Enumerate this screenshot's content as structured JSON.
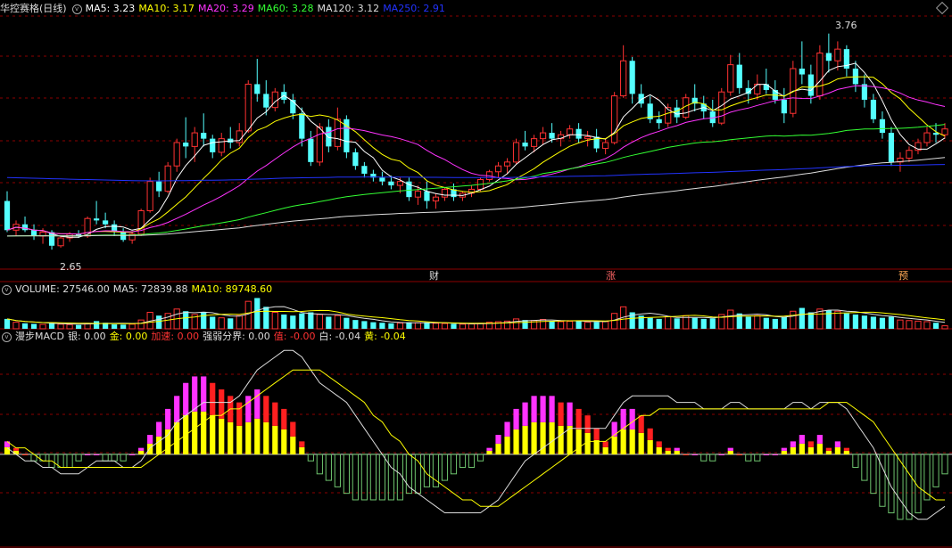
{
  "panels": {
    "price": {
      "title": "华控赛格(日线)",
      "legend": [
        {
          "label": "MA5: 3.23",
          "color": "#ffffff"
        },
        {
          "label": "MA10: 3.17",
          "color": "#ffff00"
        },
        {
          "label": "MA20: 3.29",
          "color": "#ff33ff"
        },
        {
          "label": "MA60: 3.28",
          "color": "#33ff33"
        },
        {
          "label": "MA120: 3.12",
          "color": "#dddddd"
        },
        {
          "label": "MA250: 2.91",
          "color": "#2233ff"
        }
      ],
      "high_label": "3.76",
      "low_label": "2.65",
      "markers": [
        "财",
        "涨",
        "预"
      ]
    },
    "volume": {
      "legend": [
        {
          "label": "VOLUME: 27546.00",
          "color": "#dddddd"
        },
        {
          "label": "MA5: 72839.88",
          "color": "#dddddd"
        },
        {
          "label": "MA10: 89748.60",
          "color": "#ffff00"
        }
      ]
    },
    "macd": {
      "legend": [
        {
          "label": "漫步MACD",
          "color": "#dddddd"
        },
        {
          "label": "银: 0.00",
          "color": "#dddddd"
        },
        {
          "label": "金: 0.00",
          "color": "#ffff00"
        },
        {
          "label": "加速: 0.00",
          "color": "#ff3333"
        },
        {
          "label": "强弱分界: 0.00",
          "color": "#dddddd"
        },
        {
          "label": "值: -0.00",
          "color": "#ff3333"
        },
        {
          "label": "白: -0.04",
          "color": "#dddddd"
        },
        {
          "label": "黄: -0.04",
          "color": "#ffff00"
        }
      ]
    }
  },
  "colors": {
    "up": "#ff3232",
    "down": "#54ffff",
    "grid": "#8b0000",
    "axis": "#8b0000",
    "macd_neg": "#6ec46e",
    "macd_pos_yellow": "#ffff00",
    "macd_pos_red": "#ff2020",
    "macd_pos_magenta": "#ff33ff"
  },
  "chart_data": {
    "type": "candlestick",
    "price_range": [
      2.55,
      3.85
    ],
    "candles": [
      [
        2.9,
        2.95,
        2.74,
        2.75
      ],
      [
        2.75,
        2.8,
        2.72,
        2.78
      ],
      [
        2.78,
        2.82,
        2.74,
        2.75
      ],
      [
        2.75,
        2.78,
        2.7,
        2.72
      ],
      [
        2.72,
        2.76,
        2.68,
        2.74
      ],
      [
        2.74,
        2.75,
        2.65,
        2.67
      ],
      [
        2.67,
        2.72,
        2.66,
        2.71
      ],
      [
        2.71,
        2.74,
        2.69,
        2.73
      ],
      [
        2.73,
        2.75,
        2.71,
        2.72
      ],
      [
        2.72,
        2.82,
        2.71,
        2.81
      ],
      [
        2.81,
        2.9,
        2.78,
        2.8
      ],
      [
        2.8,
        2.84,
        2.76,
        2.78
      ],
      [
        2.78,
        2.8,
        2.72,
        2.74
      ],
      [
        2.74,
        2.76,
        2.69,
        2.7
      ],
      [
        2.7,
        2.74,
        2.68,
        2.73
      ],
      [
        2.73,
        2.86,
        2.72,
        2.85
      ],
      [
        2.85,
        3.02,
        2.84,
        3.0
      ],
      [
        3.0,
        3.05,
        2.92,
        2.95
      ],
      [
        2.95,
        3.1,
        2.94,
        3.08
      ],
      [
        3.08,
        3.22,
        3.05,
        3.2
      ],
      [
        3.2,
        3.33,
        3.12,
        3.18
      ],
      [
        3.18,
        3.28,
        3.1,
        3.25
      ],
      [
        3.25,
        3.35,
        3.18,
        3.22
      ],
      [
        3.22,
        3.24,
        3.12,
        3.15
      ],
      [
        3.15,
        3.25,
        3.13,
        3.22
      ],
      [
        3.22,
        3.28,
        3.17,
        3.2
      ],
      [
        3.2,
        3.3,
        3.18,
        3.26
      ],
      [
        3.26,
        3.52,
        3.25,
        3.5
      ],
      [
        3.5,
        3.63,
        3.41,
        3.45
      ],
      [
        3.45,
        3.52,
        3.34,
        3.38
      ],
      [
        3.38,
        3.48,
        3.36,
        3.46
      ],
      [
        3.46,
        3.5,
        3.4,
        3.42
      ],
      [
        3.42,
        3.45,
        3.32,
        3.35
      ],
      [
        3.35,
        3.38,
        3.18,
        3.22
      ],
      [
        3.22,
        3.26,
        3.08,
        3.1
      ],
      [
        3.1,
        3.3,
        3.08,
        3.28
      ],
      [
        3.28,
        3.32,
        3.15,
        3.18
      ],
      [
        3.18,
        3.38,
        3.16,
        3.32
      ],
      [
        3.32,
        3.34,
        3.12,
        3.15
      ],
      [
        3.15,
        3.17,
        3.06,
        3.08
      ],
      [
        3.08,
        3.1,
        3.02,
        3.04
      ],
      [
        3.04,
        3.06,
        3.0,
        3.02
      ],
      [
        3.02,
        3.05,
        2.98,
        3.0
      ],
      [
        3.0,
        3.03,
        2.96,
        2.98
      ],
      [
        2.98,
        3.02,
        2.94,
        3.0
      ],
      [
        3.0,
        3.02,
        2.9,
        2.92
      ],
      [
        2.92,
        2.98,
        2.88,
        2.95
      ],
      [
        2.95,
        3.0,
        2.86,
        2.9
      ],
      [
        2.9,
        2.94,
        2.86,
        2.92
      ],
      [
        2.92,
        2.97,
        2.9,
        2.96
      ],
      [
        2.96,
        2.99,
        2.9,
        2.92
      ],
      [
        2.92,
        2.95,
        2.9,
        2.94
      ],
      [
        2.94,
        2.98,
        2.92,
        2.96
      ],
      [
        2.96,
        3.02,
        2.95,
        3.01
      ],
      [
        3.01,
        3.06,
        3.0,
        3.05
      ],
      [
        3.05,
        3.1,
        3.02,
        3.08
      ],
      [
        3.08,
        3.12,
        3.04,
        3.1
      ],
      [
        3.1,
        3.22,
        3.09,
        3.2
      ],
      [
        3.2,
        3.26,
        3.16,
        3.18
      ],
      [
        3.18,
        3.24,
        3.15,
        3.22
      ],
      [
        3.22,
        3.28,
        3.19,
        3.25
      ],
      [
        3.25,
        3.3,
        3.2,
        3.22
      ],
      [
        3.22,
        3.26,
        3.18,
        3.24
      ],
      [
        3.24,
        3.29,
        3.22,
        3.27
      ],
      [
        3.27,
        3.3,
        3.2,
        3.22
      ],
      [
        3.22,
        3.26,
        3.18,
        3.23
      ],
      [
        3.23,
        3.27,
        3.15,
        3.17
      ],
      [
        3.17,
        3.22,
        3.14,
        3.2
      ],
      [
        3.2,
        3.46,
        3.19,
        3.44
      ],
      [
        3.44,
        3.7,
        3.43,
        3.62
      ],
      [
        3.62,
        3.64,
        3.4,
        3.45
      ],
      [
        3.45,
        3.5,
        3.38,
        3.4
      ],
      [
        3.4,
        3.44,
        3.3,
        3.32
      ],
      [
        3.32,
        3.36,
        3.27,
        3.3
      ],
      [
        3.3,
        3.4,
        3.28,
        3.38
      ],
      [
        3.38,
        3.42,
        3.3,
        3.33
      ],
      [
        3.33,
        3.45,
        3.32,
        3.43
      ],
      [
        3.43,
        3.5,
        3.36,
        3.4
      ],
      [
        3.4,
        3.44,
        3.32,
        3.36
      ],
      [
        3.36,
        3.42,
        3.28,
        3.3
      ],
      [
        3.3,
        3.48,
        3.29,
        3.46
      ],
      [
        3.46,
        3.65,
        3.44,
        3.6
      ],
      [
        3.6,
        3.66,
        3.45,
        3.48
      ],
      [
        3.48,
        3.52,
        3.4,
        3.45
      ],
      [
        3.45,
        3.55,
        3.42,
        3.5
      ],
      [
        3.5,
        3.58,
        3.45,
        3.47
      ],
      [
        3.47,
        3.52,
        3.4,
        3.42
      ],
      [
        3.42,
        3.48,
        3.3,
        3.35
      ],
      [
        3.35,
        3.62,
        3.33,
        3.58
      ],
      [
        3.58,
        3.72,
        3.5,
        3.55
      ],
      [
        3.55,
        3.6,
        3.4,
        3.44
      ],
      [
        3.44,
        3.7,
        3.42,
        3.66
      ],
      [
        3.66,
        3.76,
        3.56,
        3.62
      ],
      [
        3.62,
        3.72,
        3.57,
        3.68
      ],
      [
        3.68,
        3.7,
        3.54,
        3.58
      ],
      [
        3.58,
        3.62,
        3.46,
        3.5
      ],
      [
        3.5,
        3.55,
        3.38,
        3.42
      ],
      [
        3.42,
        3.45,
        3.3,
        3.32
      ],
      [
        3.32,
        3.36,
        3.22,
        3.25
      ],
      [
        3.25,
        3.28,
        3.08,
        3.1
      ],
      [
        3.1,
        3.15,
        3.05,
        3.12
      ],
      [
        3.12,
        3.18,
        3.1,
        3.16
      ],
      [
        3.16,
        3.22,
        3.14,
        3.2
      ],
      [
        3.2,
        3.28,
        3.18,
        3.25
      ],
      [
        3.25,
        3.3,
        3.2,
        3.24
      ],
      [
        3.24,
        3.3,
        3.22,
        3.27
      ]
    ],
    "volume": {
      "range": [
        0,
        300000
      ],
      "values": [
        90000,
        60000,
        50000,
        45000,
        40000,
        55000,
        42000,
        38000,
        35000,
        48000,
        70000,
        55000,
        40000,
        38000,
        42000,
        80000,
        150000,
        120000,
        140000,
        180000,
        160000,
        130000,
        150000,
        110000,
        100000,
        95000,
        120000,
        250000,
        280000,
        200000,
        150000,
        130000,
        120000,
        140000,
        150000,
        130000,
        110000,
        120000,
        100000,
        80000,
        70000,
        60000,
        55000,
        50000,
        52000,
        60000,
        55000,
        58000,
        50000,
        48000,
        45000,
        42000,
        44000,
        50000,
        60000,
        65000,
        70000,
        90000,
        80000,
        75000,
        85000,
        70000,
        65000,
        68000,
        72000,
        60000,
        62000,
        65000,
        140000,
        200000,
        150000,
        120000,
        100000,
        90000,
        110000,
        95000,
        120000,
        100000,
        90000,
        95000,
        130000,
        170000,
        140000,
        110000,
        120000,
        100000,
        90000,
        110000,
        160000,
        190000,
        150000,
        180000,
        170000,
        160000,
        140000,
        130000,
        120000,
        110000,
        100000,
        110000,
        80000,
        75000,
        70000,
        65000,
        55000,
        27546
      ]
    },
    "macd": {
      "range": [
        -0.14,
        0.17
      ],
      "white": [
        0.01,
        0.0,
        -0.01,
        -0.01,
        -0.02,
        -0.02,
        -0.03,
        -0.03,
        -0.03,
        -0.02,
        -0.01,
        -0.01,
        -0.01,
        -0.02,
        -0.02,
        -0.01,
        0.01,
        0.02,
        0.03,
        0.05,
        0.06,
        0.07,
        0.08,
        0.08,
        0.08,
        0.08,
        0.09,
        0.11,
        0.13,
        0.14,
        0.15,
        0.16,
        0.16,
        0.15,
        0.13,
        0.11,
        0.1,
        0.09,
        0.08,
        0.06,
        0.04,
        0.02,
        0.0,
        -0.02,
        -0.03,
        -0.05,
        -0.06,
        -0.07,
        -0.08,
        -0.09,
        -0.09,
        -0.09,
        -0.09,
        -0.09,
        -0.08,
        -0.07,
        -0.05,
        -0.03,
        -0.01,
        0.0,
        0.01,
        0.02,
        0.03,
        0.04,
        0.04,
        0.04,
        0.04,
        0.04,
        0.06,
        0.08,
        0.09,
        0.09,
        0.09,
        0.09,
        0.09,
        0.08,
        0.08,
        0.08,
        0.07,
        0.07,
        0.07,
        0.08,
        0.08,
        0.07,
        0.07,
        0.07,
        0.07,
        0.07,
        0.08,
        0.08,
        0.07,
        0.08,
        0.08,
        0.08,
        0.07,
        0.05,
        0.03,
        0.01,
        -0.02,
        -0.05,
        -0.07,
        -0.09,
        -0.1,
        -0.1,
        -0.09,
        -0.08
      ],
      "yellow": [
        0.02,
        0.01,
        0.01,
        0.0,
        -0.01,
        -0.01,
        -0.02,
        -0.02,
        -0.02,
        -0.02,
        -0.02,
        -0.02,
        -0.02,
        -0.02,
        -0.02,
        -0.02,
        -0.01,
        0.0,
        0.01,
        0.02,
        0.03,
        0.04,
        0.05,
        0.06,
        0.06,
        0.07,
        0.07,
        0.08,
        0.09,
        0.1,
        0.11,
        0.12,
        0.13,
        0.13,
        0.13,
        0.13,
        0.12,
        0.11,
        0.1,
        0.09,
        0.08,
        0.06,
        0.05,
        0.03,
        0.02,
        0.0,
        -0.01,
        -0.03,
        -0.04,
        -0.05,
        -0.06,
        -0.07,
        -0.07,
        -0.08,
        -0.08,
        -0.08,
        -0.07,
        -0.06,
        -0.05,
        -0.04,
        -0.03,
        -0.02,
        -0.01,
        0.0,
        0.01,
        0.02,
        0.02,
        0.02,
        0.03,
        0.04,
        0.05,
        0.06,
        0.06,
        0.07,
        0.07,
        0.07,
        0.07,
        0.07,
        0.07,
        0.07,
        0.07,
        0.07,
        0.07,
        0.07,
        0.07,
        0.07,
        0.07,
        0.07,
        0.07,
        0.07,
        0.07,
        0.07,
        0.08,
        0.08,
        0.08,
        0.07,
        0.06,
        0.05,
        0.03,
        0.01,
        -0.01,
        -0.03,
        -0.05,
        -0.06,
        -0.07,
        -0.07
      ],
      "histogram": [
        0.02,
        0.01,
        0.0,
        -0.01,
        -0.01,
        -0.02,
        -0.02,
        -0.02,
        -0.01,
        0.0,
        0.0,
        -0.01,
        -0.01,
        -0.01,
        0.0,
        0.01,
        0.03,
        0.05,
        0.07,
        0.09,
        0.11,
        0.12,
        0.12,
        0.11,
        0.1,
        0.09,
        0.08,
        0.09,
        0.1,
        0.09,
        0.08,
        0.07,
        0.05,
        0.02,
        -0.01,
        -0.03,
        -0.04,
        -0.05,
        -0.06,
        -0.07,
        -0.07,
        -0.07,
        -0.07,
        -0.07,
        -0.07,
        -0.06,
        -0.06,
        -0.05,
        -0.05,
        -0.04,
        -0.03,
        -0.02,
        -0.02,
        -0.01,
        0.01,
        0.03,
        0.05,
        0.07,
        0.08,
        0.09,
        0.09,
        0.09,
        0.08,
        0.08,
        0.07,
        0.06,
        0.04,
        0.02,
        0.05,
        0.07,
        0.07,
        0.06,
        0.04,
        0.02,
        0.01,
        0.01,
        0.0,
        0.0,
        -0.01,
        -0.01,
        0.0,
        0.01,
        0.0,
        -0.01,
        -0.01,
        0.0,
        0.0,
        0.01,
        0.02,
        0.03,
        0.02,
        0.03,
        0.01,
        0.02,
        0.01,
        -0.02,
        -0.04,
        -0.06,
        -0.08,
        -0.09,
        -0.1,
        -0.1,
        -0.09,
        -0.07,
        -0.05,
        -0.03
      ]
    }
  }
}
